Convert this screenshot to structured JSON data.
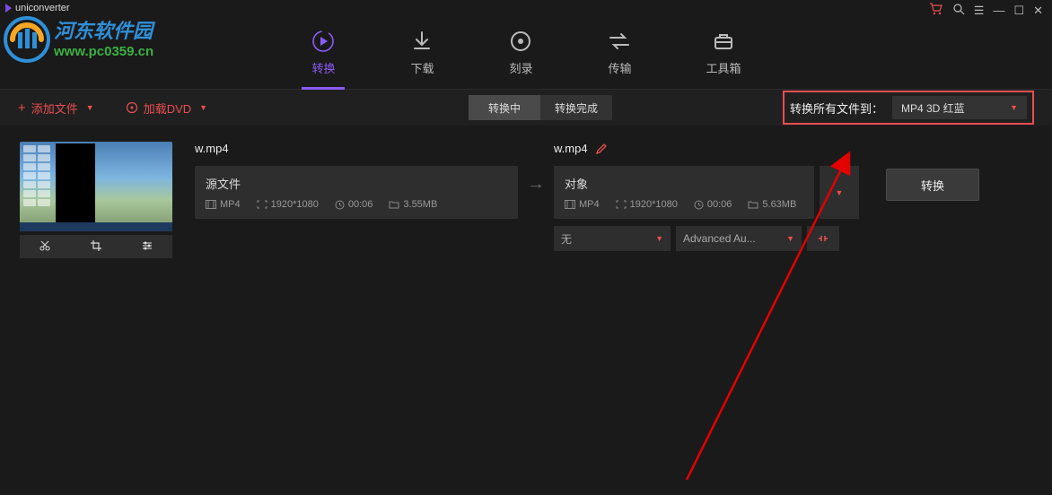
{
  "app": {
    "name": "uniconverter"
  },
  "watermark": {
    "line1": "河东软件园",
    "line2": "www.pc0359.cn"
  },
  "nav": {
    "convert": "转换",
    "download": "下载",
    "burn": "刻录",
    "transfer": "传输",
    "toolbox": "工具箱"
  },
  "toolbar": {
    "add_file": "添加文件",
    "load_dvd": "加载DVD",
    "seg_converting": "转换中",
    "seg_done": "转换完成",
    "convert_all_label": "转换所有文件到：",
    "format_value": "MP4 3D 红蓝"
  },
  "file": {
    "source_name": "w.mp4",
    "target_name": "w.mp4",
    "source_title": "源文件",
    "target_title": "对象",
    "format": "MP4",
    "resolution": "1920*1080",
    "duration": "00:06",
    "src_size": "3.55MB",
    "tgt_size": "5.63MB",
    "audio_none": "无",
    "audio_codec": "Advanced Au..."
  },
  "convert_btn": "转换"
}
